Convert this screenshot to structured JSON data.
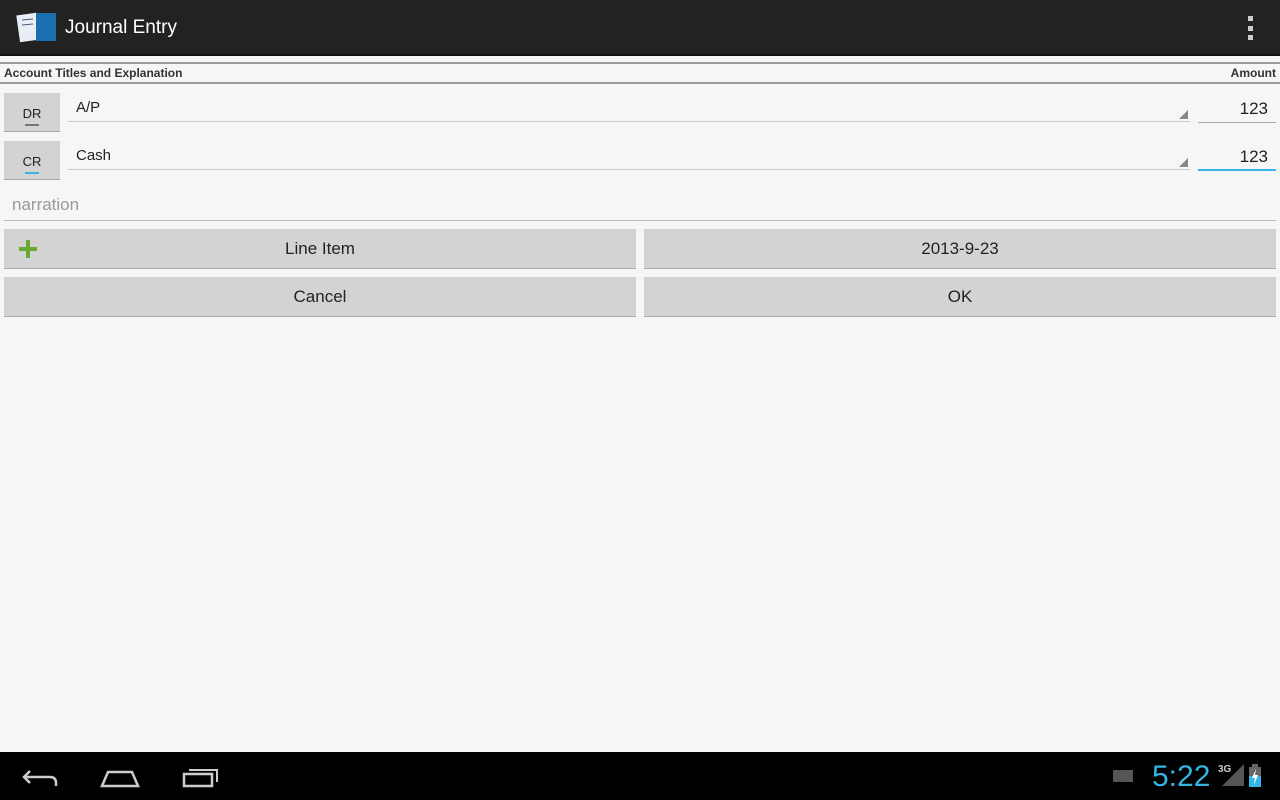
{
  "app": {
    "title": "Journal Entry"
  },
  "header": {
    "left": "Account Titles and Explanation",
    "right": "Amount"
  },
  "lines": [
    {
      "type": "DR",
      "account": "A/P",
      "amount": "123"
    },
    {
      "type": "CR",
      "account": "Cash",
      "amount": "123"
    }
  ],
  "narration": {
    "placeholder": "narration",
    "value": ""
  },
  "buttons": {
    "line_item": "Line Item",
    "date": "2013-9-23",
    "cancel": "Cancel",
    "ok": "OK"
  },
  "status": {
    "time": "5:22",
    "network": "3G"
  },
  "colors": {
    "accent": "#33b5e5",
    "plus": "#66aa33"
  }
}
